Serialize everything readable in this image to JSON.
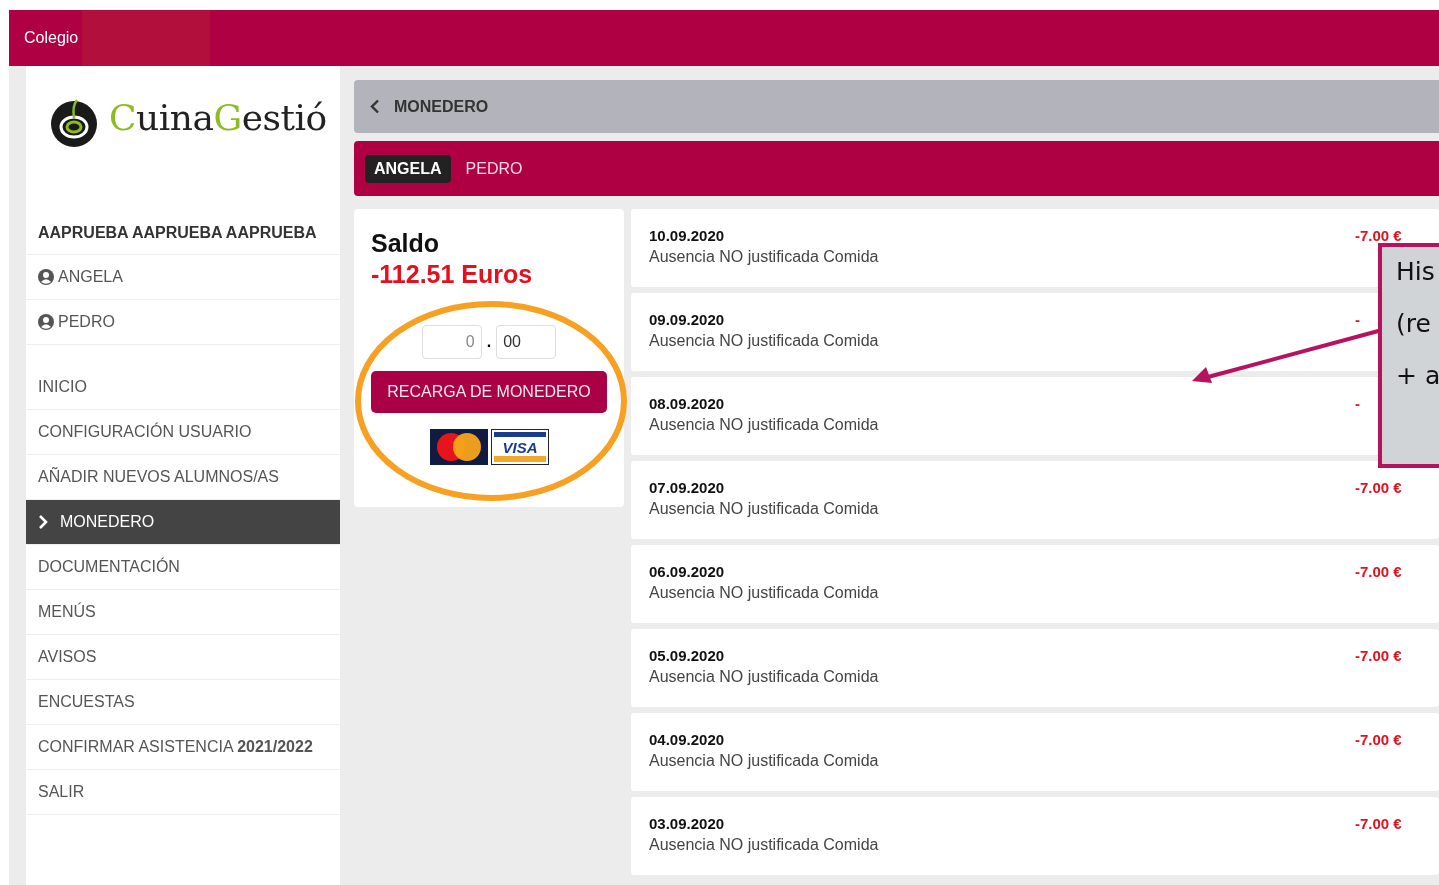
{
  "header": {
    "title": "Colegio"
  },
  "logo": {
    "parts": [
      {
        "text": "C",
        "accent": true
      },
      {
        "text": "uina",
        "accent": false
      },
      {
        "text": "G",
        "accent": true
      },
      {
        "text": "estió",
        "accent": false
      }
    ]
  },
  "sidebar": {
    "account": "AAPRUEBA AAPRUEBA AAPRUEBA",
    "students": [
      {
        "name": "ANGELA"
      },
      {
        "name": "PEDRO"
      }
    ],
    "items": [
      {
        "label": "INICIO",
        "selected": false
      },
      {
        "label": "CONFIGURACIÓN USUARIO",
        "selected": false
      },
      {
        "label": "AÑADIR NUEVOS ALUMNOS/AS",
        "selected": false
      },
      {
        "label": "MONEDERO",
        "selected": true
      },
      {
        "label": "DOCUMENTACIÓN",
        "selected": false
      },
      {
        "label": "MENÚS",
        "selected": false
      },
      {
        "label": "AVISOS",
        "selected": false
      },
      {
        "label": "ENCUESTAS",
        "selected": false
      },
      {
        "label": "CONFIRMAR ASISTENCIA **2021/2022**",
        "selected": false
      },
      {
        "label": "SALIR",
        "selected": false
      }
    ]
  },
  "page": {
    "title": "MONEDERO"
  },
  "student_tabs": [
    {
      "label": "ANGELA",
      "selected": true
    },
    {
      "label": "PEDRO",
      "selected": false
    }
  ],
  "balance": {
    "title": "Saldo",
    "amount": "-112.51 Euros",
    "units": "0",
    "separator": ".",
    "cents": "00",
    "button": "RECARGA DE MONEDERO",
    "visa_label": "VISA"
  },
  "transactions": [
    {
      "date": "10.09.2020",
      "description": "Ausencia NO justificada Comida",
      "amount": "-7.00 €"
    },
    {
      "date": "09.09.2020",
      "description": "Ausencia NO justificada Comida",
      "amount": "-"
    },
    {
      "date": "08.09.2020",
      "description": "Ausencia NO justificada Comida",
      "amount": "-"
    },
    {
      "date": "07.09.2020",
      "description": "Ausencia NO justificada Comida",
      "amount": "-7.00 €"
    },
    {
      "date": "06.09.2020",
      "description": "Ausencia NO justificada Comida",
      "amount": "-7.00 €"
    },
    {
      "date": "05.09.2020",
      "description": "Ausencia NO justificada Comida",
      "amount": "-7.00 €"
    },
    {
      "date": "04.09.2020",
      "description": "Ausencia NO justificada Comida",
      "amount": "-7.00 €"
    },
    {
      "date": "03.09.2020",
      "description": "Ausencia NO justificada Comida",
      "amount": "-7.00 €"
    }
  ],
  "annotation": {
    "lines": [
      "His",
      "(re",
      "+ a"
    ]
  }
}
